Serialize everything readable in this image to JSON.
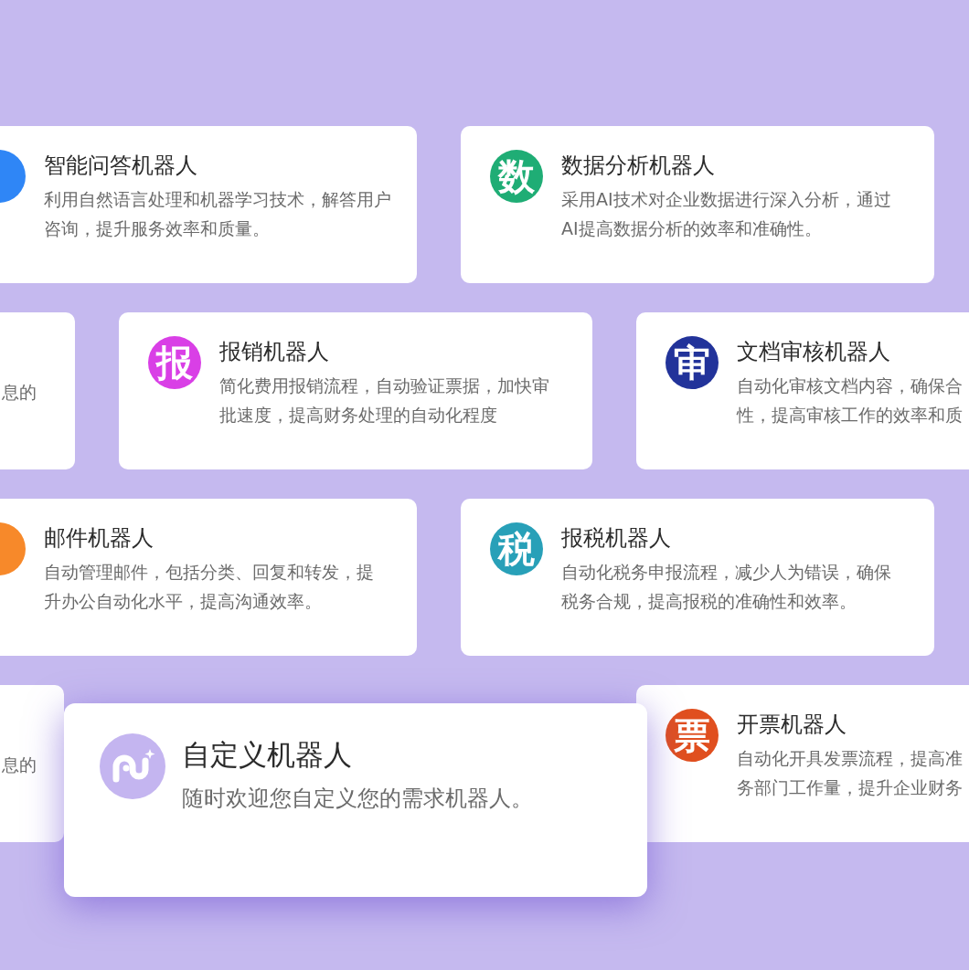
{
  "rows": [
    {
      "cards": [
        {
          "kind": "full",
          "icon": {
            "color": "#2f86f6"
          },
          "title": "智能问答机器人",
          "lines": [
            "利用自然语言处理和机器学习技术，解答用户",
            "咨询，提升服务效率和质量。"
          ]
        },
        {
          "kind": "full",
          "icon": {
            "char": "数",
            "color": "#1fad75"
          },
          "title": "数据分析机器人",
          "lines": [
            "采用AI技术对企业数据进行深入分析，通过",
            "AI提高数据分析的效率和准确性。"
          ]
        }
      ]
    },
    {
      "cards": [
        {
          "kind": "edge",
          "lines": [
            "息的"
          ]
        },
        {
          "kind": "full",
          "icon": {
            "char": "报",
            "color": "#d93fe6"
          },
          "title": "报销机器人",
          "lines": [
            "简化费用报销流程，自动验证票据，加快审",
            "批速度，提高财务处理的自动化程度"
          ]
        },
        {
          "kind": "full",
          "icon": {
            "char": "审",
            "color": "#22339a"
          },
          "title": "文档审核机器人",
          "lines": [
            "自动化审核文档内容，确保合",
            "性，提高审核工作的效率和质"
          ]
        }
      ]
    },
    {
      "cards": [
        {
          "kind": "full",
          "icon": {
            "color": "#f7892a"
          },
          "title": "邮件机器人",
          "lines": [
            "自动管理邮件，包括分类、回复和转发，提",
            "升办公自动化水平，提高沟通效率。"
          ]
        },
        {
          "kind": "full",
          "icon": {
            "char": "税",
            "color": "#28a0b8"
          },
          "title": "报税机器人",
          "lines": [
            "自动化税务申报流程，减少人为错误，确保",
            "税务合规，提高报税的准确性和效率。"
          ]
        }
      ]
    },
    {
      "cards": [
        {
          "kind": "edge",
          "lines": [
            "息的"
          ]
        },
        {
          "kind": "spacer"
        },
        {
          "kind": "full",
          "icon": {
            "char": "票",
            "color": "#e04f1f"
          },
          "title": "开票机器人",
          "lines": [
            "自动化开具发票流程，提高准",
            "务部门工作量，提升企业财务"
          ]
        }
      ]
    }
  ],
  "featured": {
    "title": "自定义机器人",
    "description": "随时欢迎您自定义您的需求机器人。"
  }
}
